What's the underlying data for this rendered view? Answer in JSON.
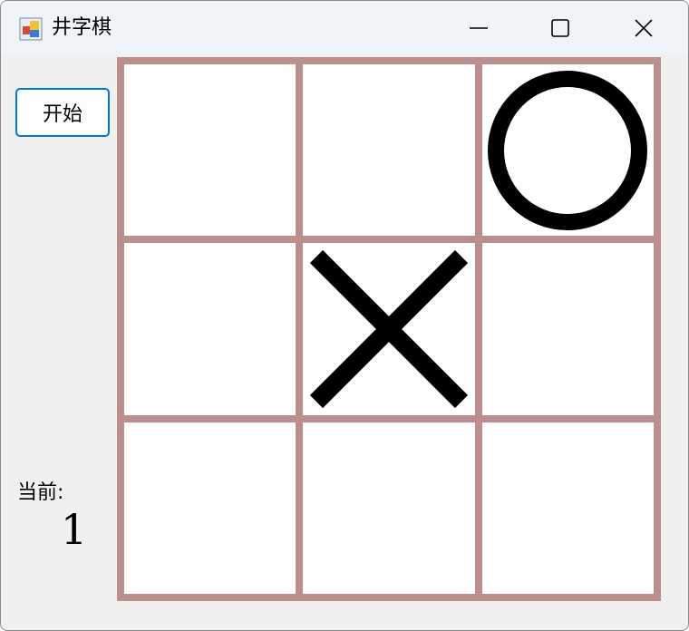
{
  "window": {
    "title": "井字棋",
    "icon": "app-icon",
    "controls": [
      "minimize-icon",
      "maximize-icon",
      "close-icon"
    ]
  },
  "controls": {
    "start_label": "开始",
    "current_label": "当前:",
    "current_value": "1"
  },
  "board": {
    "line_color": "#bc8f8f",
    "cells": [
      "",
      "",
      "O",
      "",
      "X",
      "",
      "",
      "",
      ""
    ]
  }
}
